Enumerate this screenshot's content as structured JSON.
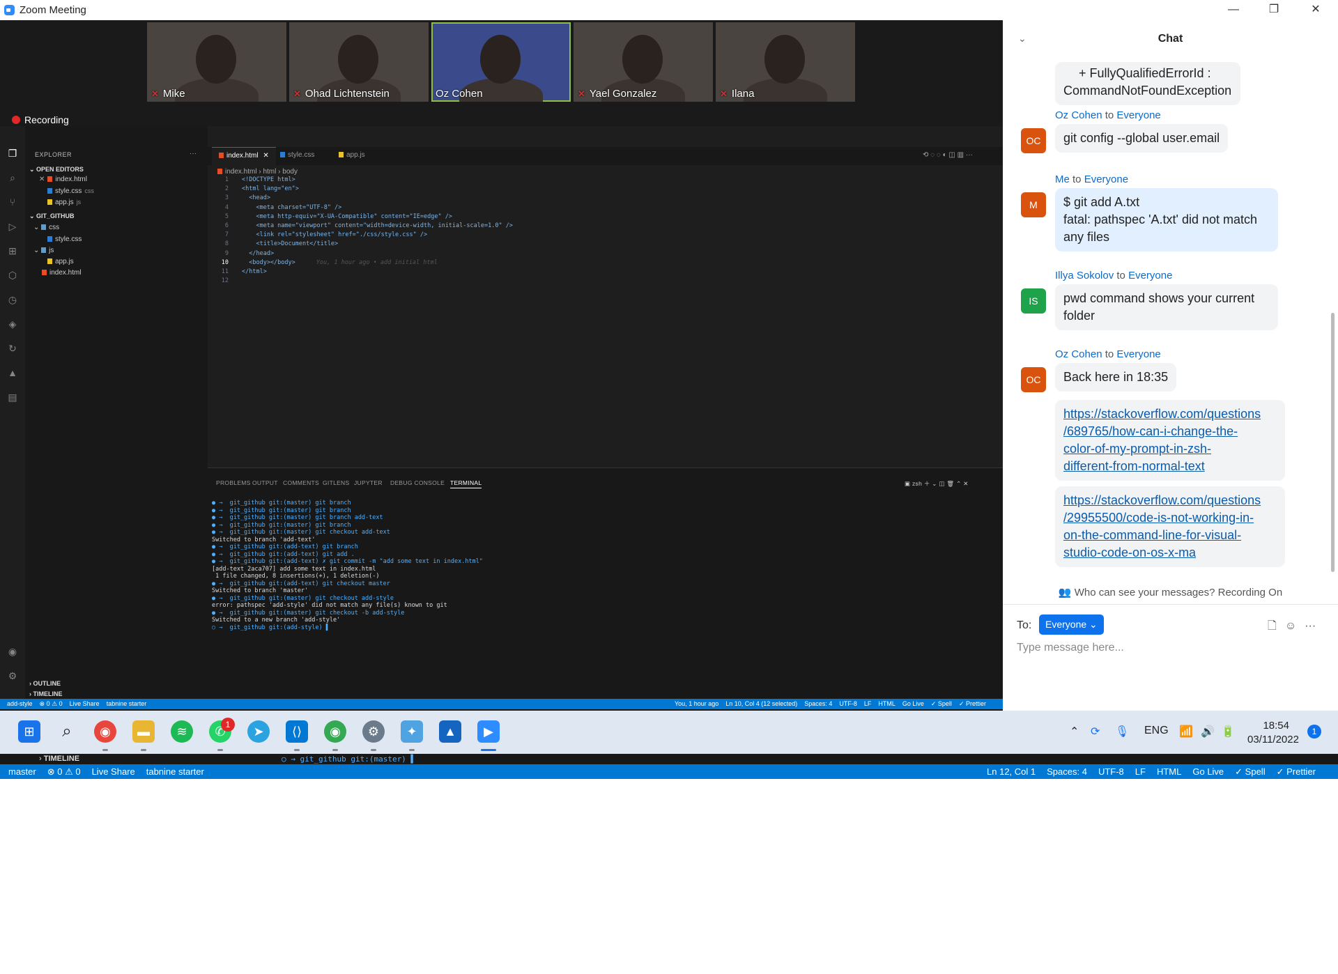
{
  "window": {
    "title": "Zoom Meeting",
    "minimize": "—",
    "restore": "❐",
    "close": "✕"
  },
  "participants": [
    {
      "name": "Mike"
    },
    {
      "name": "Ohad Lichtenstein"
    },
    {
      "name": "Oz Cohen"
    },
    {
      "name": "Yael Gonzalez"
    },
    {
      "name": "Ilana"
    }
  ],
  "recording_label": "Recording",
  "vscode": {
    "explorer_title": "EXPLORER",
    "open_editors_label": "OPEN EDITORS",
    "open_editors": [
      {
        "name": "index.html",
        "tag": ""
      },
      {
        "name": "style.css",
        "tag": "css"
      },
      {
        "name": "app.js",
        "tag": "js"
      }
    ],
    "workspace_label": "GIT_GITHUB",
    "tree": [
      {
        "name": "css"
      },
      {
        "name": "style.css"
      },
      {
        "name": "js"
      },
      {
        "name": "app.js"
      },
      {
        "name": "index.html"
      }
    ],
    "outline_label": "OUTLINE",
    "timeline_label": "TIMELINE",
    "tabs": [
      {
        "label": "index.html"
      },
      {
        "label": "style.css"
      },
      {
        "label": "app.js"
      }
    ],
    "breadcrumb": [
      "index.html",
      "html",
      "body"
    ],
    "code_lines": [
      "<!DOCTYPE html>",
      "<html lang=\"en\">",
      "  <head>",
      "    <meta charset=\"UTF-8\" />",
      "    <meta http-equiv=\"X-UA-Compatible\" content=\"IE=edge\" />",
      "    <meta name=\"viewport\" content=\"width=device-width, initial-scale=1.0\" />",
      "    <link rel=\"stylesheet\" href=\"./css/style.css\" />",
      "    <title>Document</title>",
      "  </head>",
      "  <body></body>",
      "</html>",
      ""
    ],
    "blame": "You, 1 hour ago • add initial html",
    "panel_tabs": [
      "PROBLEMS",
      "OUTPUT",
      "COMMENTS",
      "GITLENS",
      "JUPYTER",
      "DEBUG CONSOLE",
      "TERMINAL"
    ],
    "shell": "zsh",
    "terminal_lines": [
      "● →  git_github git:(master) git branch",
      "● →  git_github git:(master) git branch",
      "● →  git_github git:(master) git branch add-text",
      "● →  git_github git:(master) git branch",
      "● →  git_github git:(master) git checkout add-text",
      "Switched to branch 'add-text'",
      "● →  git_github git:(add-text) git branch",
      "● →  git_github git:(add-text) git add .",
      "● →  git_github git:(add-text) ✗ git commit -m \"add some text in index.html\"",
      "[add-text 2aca707] add some text in index.html",
      " 1 file changed, 8 insertions(+), 1 deletion(-)",
      "● →  git_github git:(add-text) git checkout master",
      "Switched to branch 'master'",
      "● →  git_github git:(master) git checkout add-style",
      "error: pathspec 'add-style' did not match any file(s) known to git",
      "● →  git_github git:(master) git checkout -b add-style",
      "Switched to a new branch 'add-style'",
      "○ →  git_github git:(add-style) ▌"
    ],
    "status_left": [
      "add-style",
      "⊗ 0 ⚠ 0",
      "Live Share",
      "tabnine starter"
    ],
    "status_right": [
      "You, 1 hour ago",
      "Ln 10, Col 4 (12 selected)",
      "Spaces: 4",
      "UTF-8",
      "LF",
      "HTML",
      "Go Live",
      "✓ Spell",
      "✓ Prettier"
    ]
  },
  "chat": {
    "title": "Chat",
    "messages": [
      {
        "type": "continuation",
        "text_lines": [
          "+ FullyQualifiedErrorId :",
          "CommandNotFoundException"
        ]
      },
      {
        "sender": "Oz Cohen",
        "to": "to",
        "recipient": "Everyone",
        "initials": "OC",
        "text_lines": [
          "git config --global user.email"
        ]
      },
      {
        "sender": "Me",
        "to": "to",
        "recipient": "Everyone",
        "initials": "M",
        "text_lines": [
          "$ git add A.txt",
          "fatal: pathspec 'A.txt' did not match",
          "any files"
        ]
      },
      {
        "sender": "Illya Sokolov",
        "to": "to",
        "recipient": "Everyone",
        "initials": "IS",
        "text_lines": [
          "pwd command shows your current",
          "folder"
        ]
      },
      {
        "sender": "Oz Cohen",
        "to": "to",
        "recipient": "Everyone",
        "initials": "OC",
        "text_lines": [
          "Back here in 18:35"
        ]
      },
      {
        "type": "link",
        "text_lines": [
          "https://stackoverflow.com/questions",
          "/689765/how-can-i-change-the-",
          "color-of-my-prompt-in-zsh-",
          "different-from-normal-text"
        ]
      },
      {
        "type": "link",
        "text_lines": [
          "https://stackoverflow.com/questions",
          "/29955500/code-is-not-working-in-",
          "on-the-command-line-for-visual-",
          "studio-code-on-os-x-ma"
        ]
      }
    ],
    "privacy": "Who can see your messages? Recording On",
    "to_label": "To:",
    "to_value": "Everyone",
    "input_placeholder": "Type message here..."
  },
  "taskbar": {
    "whatsapp_badge": "1",
    "tray_lang": "ENG",
    "time": "18:54",
    "date": "03/11/2022",
    "notification_count": "1"
  },
  "bottom_strip": {
    "timeline": "TIMELINE",
    "prompt": "○ →  git_github git:(master) ▌"
  },
  "bottom_status": {
    "left": [
      "master",
      "⊗ 0 ⚠ 0",
      "Live Share",
      "tabnine starter"
    ],
    "right": [
      "Ln 12, Col 1",
      "Spaces: 4",
      "UTF-8",
      "LF",
      "HTML",
      "Go Live",
      "✓ Spell",
      "✓ Prettier"
    ]
  },
  "colors": {
    "zoom_blue": "#0e72ed",
    "vscode_status": "#0078d4",
    "mute_red": "#e02828",
    "avatar_orange": "#d9530f",
    "avatar_green": "#1fa34a"
  }
}
